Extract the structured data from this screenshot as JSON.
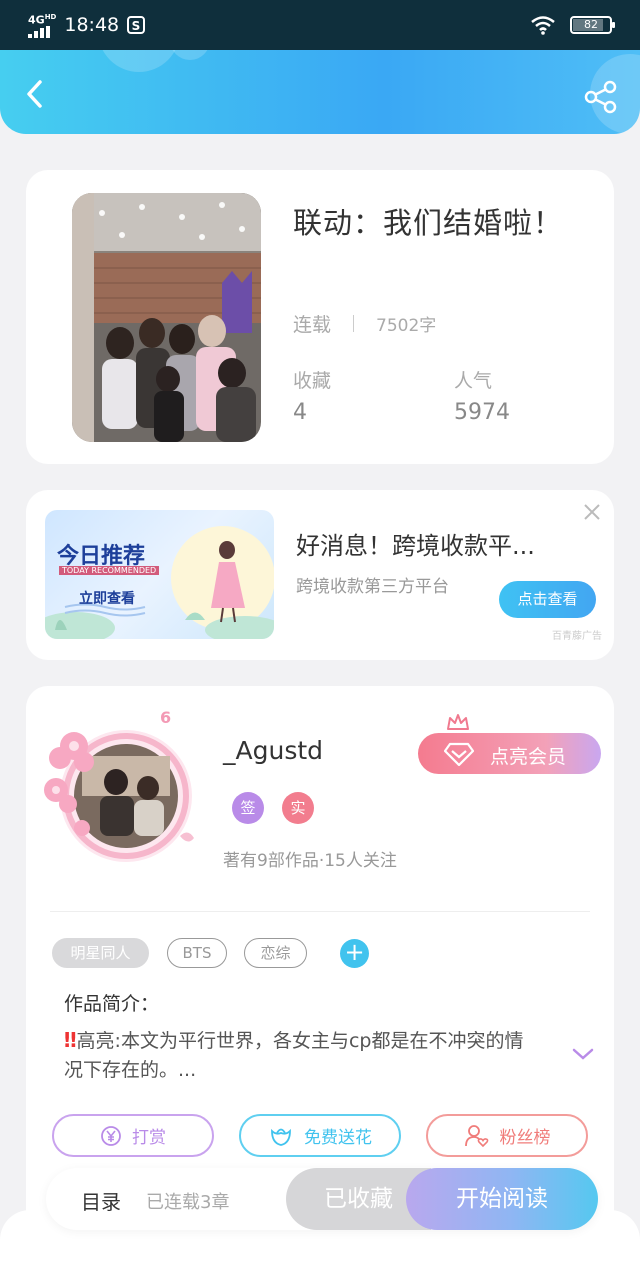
{
  "status_bar": {
    "network": "4G",
    "network_sup": "HD",
    "time": "18:48",
    "app_icon": "s-square-icon",
    "battery": "82"
  },
  "header": {
    "back_icon": "chevron-left-icon",
    "share_icon": "share-icon"
  },
  "book": {
    "title": "联动：我们结婚啦！",
    "status": "连载",
    "word_count": "7502字",
    "favorites_label": "收藏",
    "favorites_value": "4",
    "popularity_label": "人气",
    "popularity_value": "5974"
  },
  "ad": {
    "banner_title": "今日推荐",
    "banner_subtitle": "TODAY RECOMMENDED",
    "banner_cta": "立即查看",
    "title": "好消息！跨境收款平...",
    "description": "跨境收款第三方平台",
    "button": "点击查看",
    "source": "百青藤广告"
  },
  "author": {
    "level": "6",
    "name": "_Agustd",
    "badge_sign": "签",
    "badge_real": "实",
    "stats": "著有9部作品·15人关注",
    "vip_button": "点亮会员",
    "colors": {
      "sign": "#b98be8",
      "real": "#f27d8e"
    }
  },
  "tags": [
    "明星同人",
    "BTS",
    "恋综"
  ],
  "intro": {
    "label": "作品简介：",
    "text": "高亮:本文为平行世界，各女主与cp都是在不冲突的情况下存在的。...",
    "mark": "‼"
  },
  "actions": {
    "reward": "打赏",
    "flower": "免费送花",
    "fans": "粉丝榜",
    "reward_color": "#b98be8",
    "flower_color": "#41c3ee",
    "fans_color": "#f07c7a"
  },
  "bottom": {
    "toc": "目录",
    "chapters": "已连载3章",
    "collected": "已收藏",
    "read": "开始阅读"
  }
}
